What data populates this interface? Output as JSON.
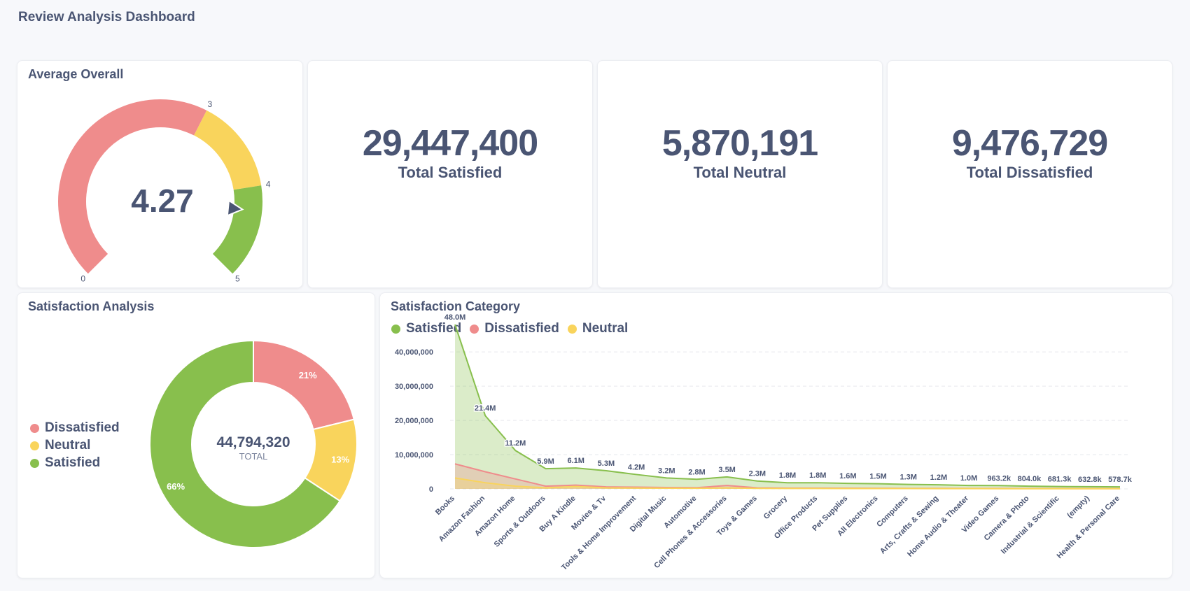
{
  "dashboard": {
    "title": "Review Analysis Dashboard"
  },
  "colors": {
    "satisfied": "#88bf4d",
    "dissatisfied": "#ef8c8c",
    "neutral": "#f9d45c",
    "text": "#4a5573"
  },
  "gauge": {
    "title": "Average Overall",
    "value": "4.27",
    "value_num": 4.27,
    "min": 0,
    "max": 5,
    "segments": [
      {
        "from": 0,
        "to": 3,
        "color": "#ef8c8c"
      },
      {
        "from": 3,
        "to": 4,
        "color": "#f9d45c"
      },
      {
        "from": 4,
        "to": 5,
        "color": "#88bf4d"
      }
    ],
    "tick_labels": [
      "0",
      "3",
      "4",
      "5"
    ]
  },
  "kpis": [
    {
      "value": "29,447,400",
      "label": "Total Satisfied"
    },
    {
      "value": "5,870,191",
      "label": "Total Neutral"
    },
    {
      "value": "9,476,729",
      "label": "Total Dissatisfied"
    }
  ],
  "satisfaction_analysis": {
    "title": "Satisfaction Analysis",
    "legend": [
      "Dissatisfied",
      "Neutral",
      "Satisfied"
    ],
    "total_value": "44,794,320",
    "total_label": "TOTAL"
  },
  "satisfaction_category": {
    "title": "Satisfaction Category"
  },
  "chart_data": [
    {
      "type": "pie",
      "title": "Satisfaction Analysis",
      "categories": [
        "Dissatisfied",
        "Neutral",
        "Satisfied"
      ],
      "values": [
        9476729,
        5870191,
        29447400
      ],
      "labels": [
        "21%",
        "13%",
        "66%"
      ],
      "colors": [
        "#ef8c8c",
        "#f9d45c",
        "#88bf4d"
      ],
      "legend": "left"
    },
    {
      "type": "area",
      "title": "Satisfaction Category",
      "legend": "top-left",
      "categories": [
        "Books",
        "Amazon Fashion",
        "Amazon Home",
        "Sports & Outdoors",
        "Buy A Kindle",
        "Movies & Tv",
        "Tools & Home Improvement",
        "Digital Music",
        "Automotive",
        "Cell Phones & Accessories",
        "Toys & Games",
        "Grocery",
        "Office Products",
        "Pet Supplies",
        "All Electronics",
        "Computers",
        "Arts, Crafts & Sewing",
        "Home Audio & Theater",
        "Video Games",
        "Camera & Photo",
        "Industrial & Scientific",
        "(empty)",
        "Health & Personal Care"
      ],
      "data_labels": [
        "48.0M",
        "21.4M",
        "11.2M",
        "5.9M",
        "6.1M",
        "5.3M",
        "4.2M",
        "3.2M",
        "2.8M",
        "3.5M",
        "2.3M",
        "1.8M",
        "1.8M",
        "1.6M",
        "1.5M",
        "1.3M",
        "1.2M",
        "1.0M",
        "963.2k",
        "804.0k",
        "681.3k",
        "632.8k",
        "578.7k"
      ],
      "series": [
        {
          "name": "Satisfied",
          "color": "#88bf4d",
          "values": [
            48000000,
            21400000,
            11200000,
            5900000,
            6100000,
            5300000,
            4200000,
            3200000,
            2800000,
            3500000,
            2300000,
            1800000,
            1800000,
            1600000,
            1500000,
            1300000,
            1200000,
            1000000,
            963200,
            804000,
            681300,
            632800,
            578700
          ]
        },
        {
          "name": "Dissatisfied",
          "color": "#ef8c8c",
          "values": [
            7300000,
            5000000,
            2900000,
            800000,
            1100000,
            600000,
            500000,
            400000,
            350000,
            1000000,
            300000,
            220000,
            220000,
            200000,
            180000,
            160000,
            150000,
            130000,
            120000,
            100000,
            90000,
            80000,
            70000
          ]
        },
        {
          "name": "Neutral",
          "color": "#f9d45c",
          "values": [
            3200000,
            1800000,
            800000,
            300000,
            700000,
            300000,
            250000,
            200000,
            180000,
            300000,
            150000,
            120000,
            120000,
            110000,
            100000,
            90000,
            80000,
            70000,
            60000,
            55000,
            50000,
            45000,
            40000
          ]
        }
      ],
      "yticks": [
        "0",
        "10,000,000",
        "20,000,000",
        "30,000,000",
        "40,000,000"
      ],
      "ylim": [
        0,
        48000000
      ],
      "grid": true
    }
  ]
}
